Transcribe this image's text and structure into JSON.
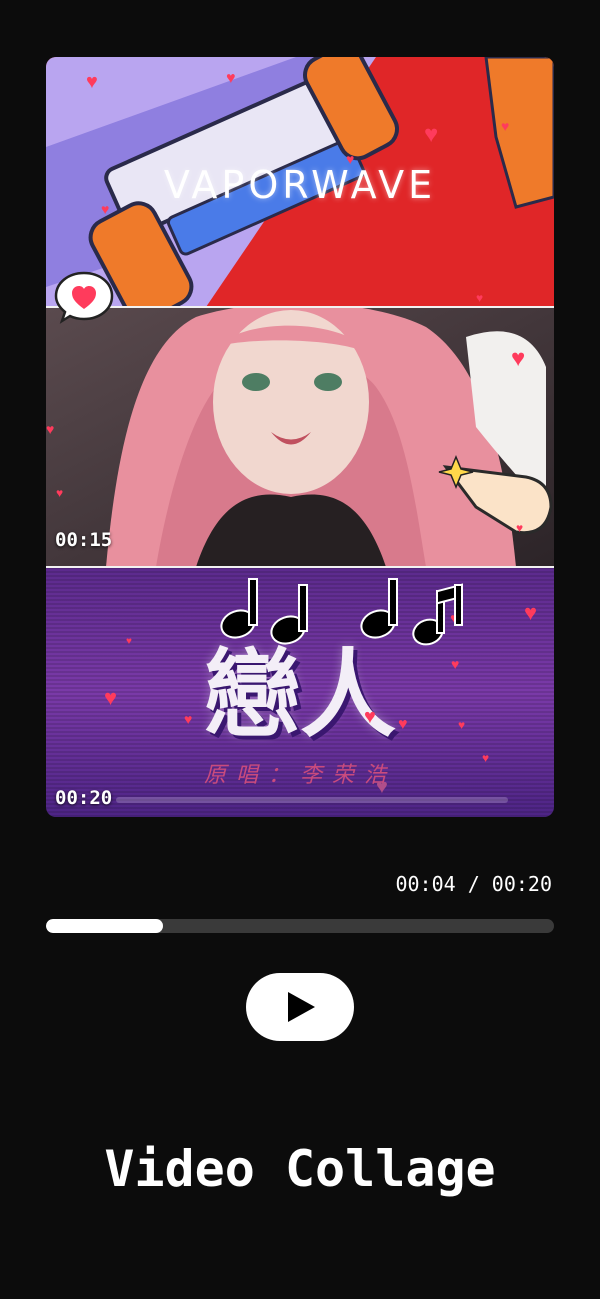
{
  "collage": {
    "panel1": {
      "title": "VAPORWAVE"
    },
    "panel2": {
      "timestamp": "00:15"
    },
    "panel3": {
      "title": "戀人",
      "subtitle": "原唱：李荣浩",
      "timestamp": "00:20"
    }
  },
  "player": {
    "time_readout": "00:04 / 00:20",
    "progress": 0.23,
    "play_icon": "play-icon"
  },
  "app_title": "Video Collage",
  "colors": {
    "background": "#0c0c0c",
    "accent_red": "#e02628",
    "accent_purple": "#6a2f9a",
    "heart": "#ff3b5c",
    "progress_track": "#3a3a3a",
    "progress_fill": "#ffffff"
  }
}
